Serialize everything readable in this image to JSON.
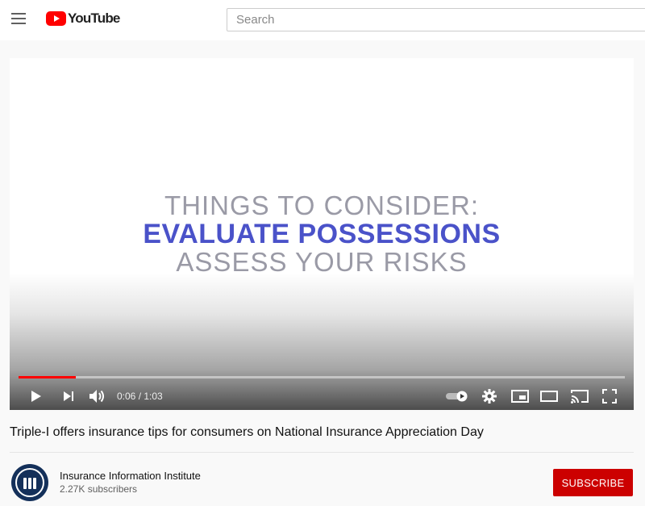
{
  "header": {
    "logo_text": "YouTube",
    "search_placeholder": "Search"
  },
  "player": {
    "title_card": {
      "line1": "THINGS TO CONSIDER:",
      "line2": "EVALUATE POSSESSIONS",
      "line3": "ASSESS YOUR RISKS"
    },
    "progress_fraction": 0.095,
    "current_time": "0:06",
    "duration": "1:03",
    "time_display": "0:06 / 1:03"
  },
  "video": {
    "title": "Triple-I offers insurance tips for consumers on National Insurance Appreciation Day"
  },
  "channel": {
    "name": "Insurance Information Institute",
    "subscribers": "2.27K subscribers",
    "subscribe_label": "SUBSCRIBE"
  },
  "colors": {
    "brand_red": "#ff0000",
    "subscribe_red": "#cc0000",
    "title_card_blue": "#4a52c9",
    "title_card_gray": "#9a9aa6"
  },
  "icons": [
    "menu-icon",
    "youtube-logo-icon",
    "play-icon",
    "next-icon",
    "volume-icon",
    "autoplay-toggle-icon",
    "settings-icon",
    "miniplayer-icon",
    "theater-mode-icon",
    "cast-icon",
    "fullscreen-icon"
  ]
}
